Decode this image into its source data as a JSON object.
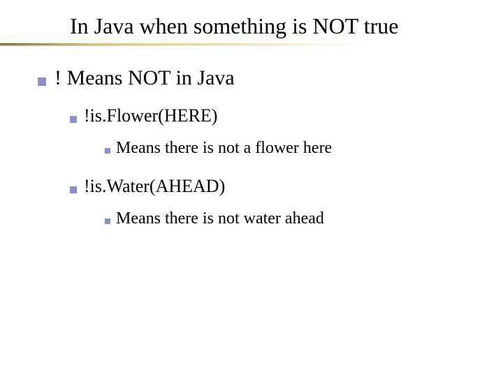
{
  "title": "In Java when something is NOT true",
  "points": [
    {
      "text": "! Means NOT in Java",
      "children": [
        {
          "text": "!is.Flower(HERE)",
          "children": [
            {
              "text": "Means there is not a flower here"
            }
          ]
        },
        {
          "text": "!is.Water(AHEAD)",
          "children": [
            {
              "text": "Means there is not water ahead"
            }
          ]
        }
      ]
    }
  ]
}
